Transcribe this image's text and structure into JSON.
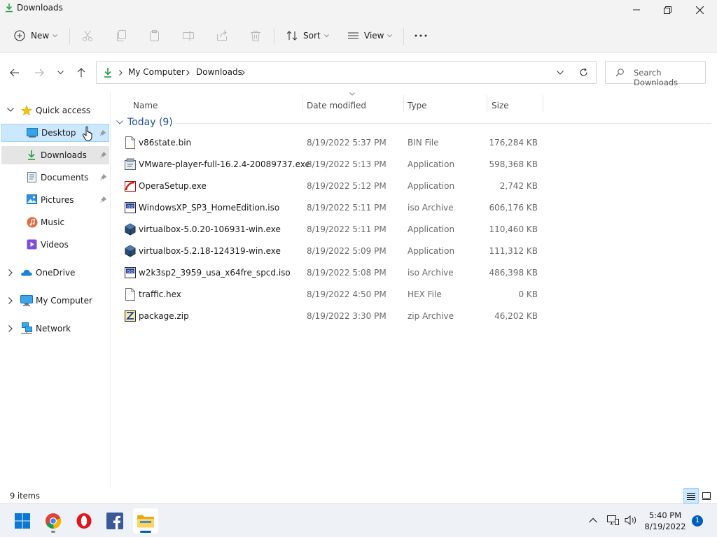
{
  "window": {
    "title": "Downloads"
  },
  "toolbar": {
    "new_label": "New",
    "sort_label": "Sort",
    "view_label": "View"
  },
  "address": {
    "crumbs": [
      "My Computer",
      "Downloads"
    ],
    "search_placeholder": "Search Downloads"
  },
  "sidebar": {
    "quick_access": "Quick access",
    "items": [
      {
        "label": "Desktop",
        "icon": "desktop-icon",
        "pinned": true,
        "state": "selected"
      },
      {
        "label": "Downloads",
        "icon": "download-icon",
        "pinned": true,
        "state": "highlight"
      },
      {
        "label": "Documents",
        "icon": "documents-icon",
        "pinned": true
      },
      {
        "label": "Pictures",
        "icon": "pictures-icon",
        "pinned": true
      },
      {
        "label": "Music",
        "icon": "music-icon",
        "pinned": false
      },
      {
        "label": "Videos",
        "icon": "videos-icon",
        "pinned": false
      }
    ],
    "roots": [
      "OneDrive",
      "My Computer",
      "Network"
    ]
  },
  "list": {
    "columns": [
      "Name",
      "Date modified",
      "Type",
      "Size"
    ],
    "group_label": "Today (9)",
    "files": [
      {
        "name": "v86state.bin",
        "date": "8/19/2022 5:37 PM",
        "type": "BIN File",
        "size": "176,284 KB",
        "icon": "file-icon"
      },
      {
        "name": "VMware-player-full-16.2.4-20089737.exe",
        "date": "8/19/2022 5:13 PM",
        "type": "Application",
        "size": "598,368 KB",
        "icon": "installer-icon"
      },
      {
        "name": "OperaSetup.exe",
        "date": "8/19/2022 5:12 PM",
        "type": "Application",
        "size": "2,742 KB",
        "icon": "opera-setup-icon"
      },
      {
        "name": "WindowsXP_SP3_HomeEdition.iso",
        "date": "8/19/2022 5:11 PM",
        "type": "iso Archive",
        "size": "606,176 KB",
        "icon": "iso-icon"
      },
      {
        "name": "virtualbox-5.0.20-106931-win.exe",
        "date": "8/19/2022 5:11 PM",
        "type": "Application",
        "size": "110,460 KB",
        "icon": "virtualbox-icon"
      },
      {
        "name": "virtualbox-5.2.18-124319-win.exe",
        "date": "8/19/2022 5:09 PM",
        "type": "Application",
        "size": "111,312 KB",
        "icon": "virtualbox-icon"
      },
      {
        "name": "w2k3sp2_3959_usa_x64fre_spcd.iso",
        "date": "8/19/2022 5:08 PM",
        "type": "iso Archive",
        "size": "486,398 KB",
        "icon": "iso-icon"
      },
      {
        "name": "traffic.hex",
        "date": "8/19/2022 4:50 PM",
        "type": "HEX File",
        "size": "0 KB",
        "icon": "file-icon"
      },
      {
        "name": "package.zip",
        "date": "8/19/2022 3:30 PM",
        "type": "zip Archive",
        "size": "46,202 KB",
        "icon": "zip-icon"
      }
    ]
  },
  "status": {
    "item_count": "9 items"
  },
  "taskbar": {
    "time": "5:40 PM",
    "date": "8/19/2022",
    "notifications": "1"
  },
  "colors": {
    "accent": "#005fb8",
    "selection": "#cce8ff",
    "group_header": "#1f4e99"
  }
}
